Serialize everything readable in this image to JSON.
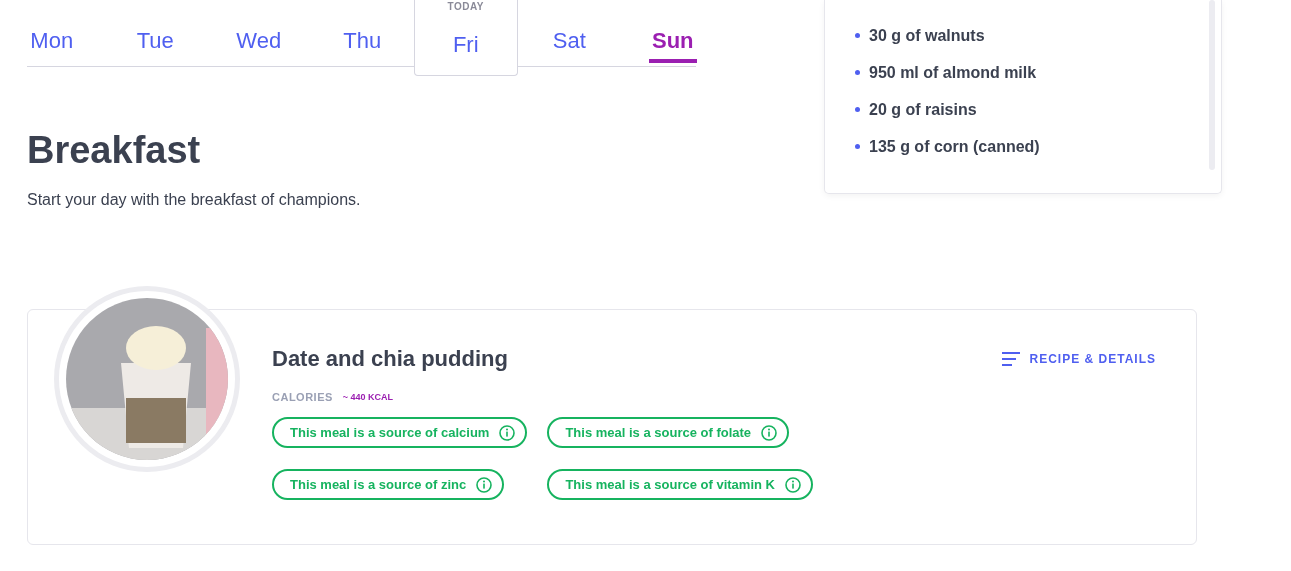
{
  "days": [
    {
      "label": "Mon",
      "selected": false
    },
    {
      "label": "Tue",
      "selected": false
    },
    {
      "label": "Wed",
      "selected": false
    },
    {
      "label": "Thu",
      "selected": false
    },
    {
      "label": "Fri",
      "selected": false,
      "note": "TODAY"
    },
    {
      "label": "Sat",
      "selected": false
    },
    {
      "label": "Sun",
      "selected": true
    }
  ],
  "section": {
    "title": "Breakfast",
    "subtitle": "Start your day with the breakfast of champions."
  },
  "ingredients": [
    "30 g of walnuts",
    "950 ml of almond milk",
    "20 g of raisins",
    "135 g of corn (canned)"
  ],
  "meal": {
    "name": "Date and chia pudding",
    "calories_label": "CALORIES",
    "calories": "~ 440 KCAL",
    "details_link": "RECIPE & DETAILS",
    "tags": [
      "This meal is a source of calcium",
      "This meal is a source of folate",
      "This meal is a source of zinc",
      "This meal is a source of vitamin K"
    ]
  }
}
